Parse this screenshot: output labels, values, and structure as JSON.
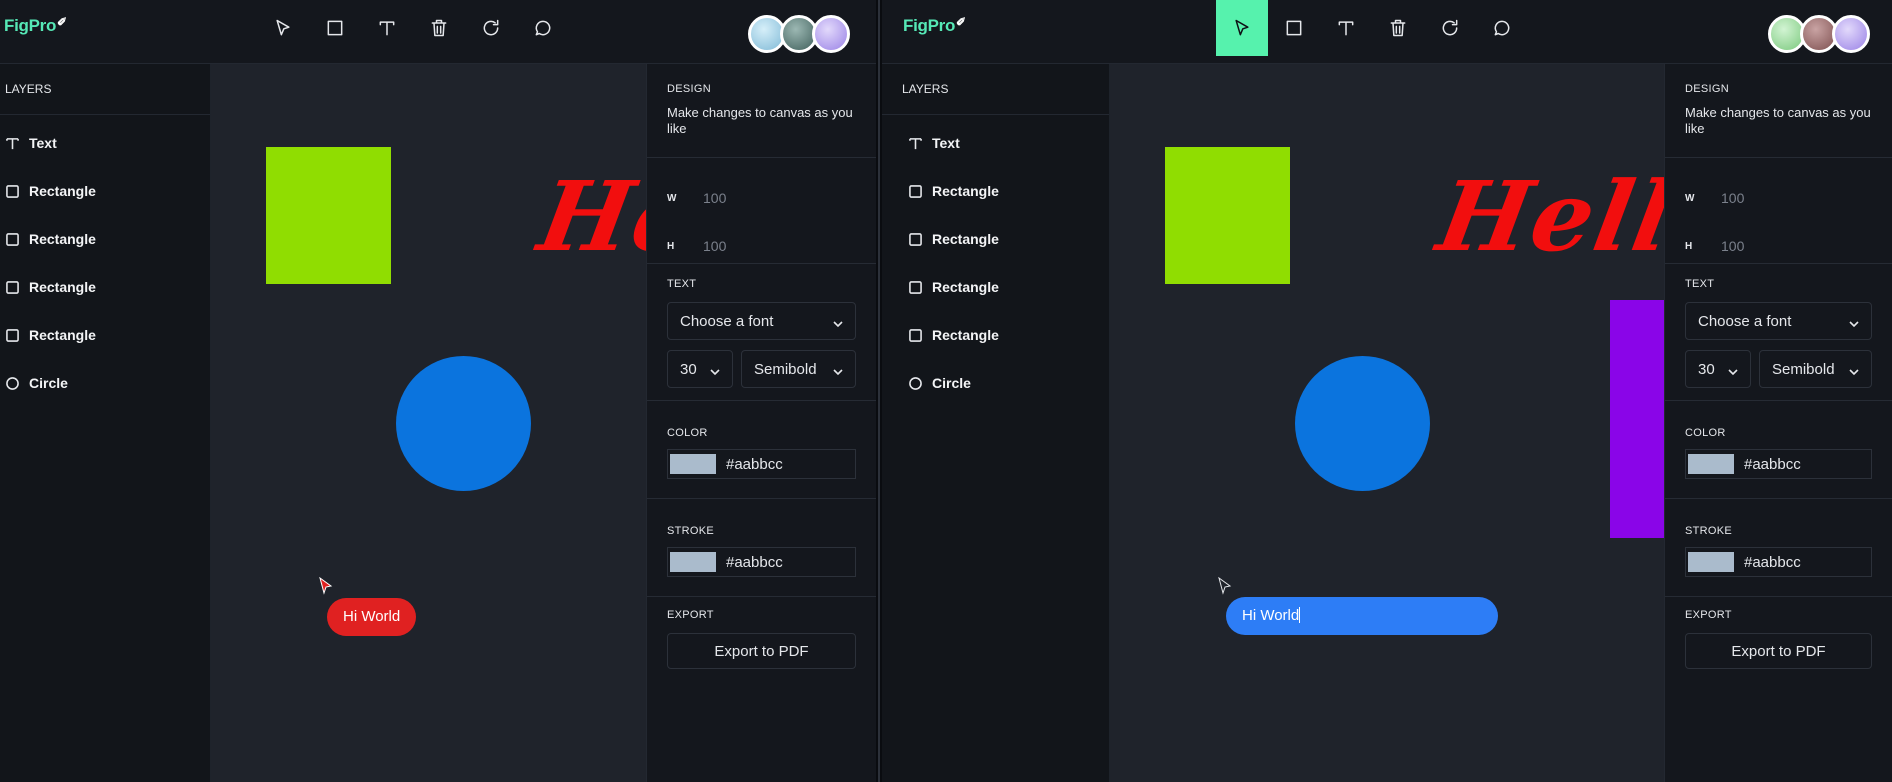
{
  "left_window": {
    "logo": "FigPro",
    "layers_title": "LAYERS",
    "layers": [
      {
        "label": "Text",
        "icon": "text-icon"
      },
      {
        "label": "Rectangle",
        "icon": "square-icon"
      },
      {
        "label": "Rectangle",
        "icon": "square-icon"
      },
      {
        "label": "Rectangle",
        "icon": "square-icon"
      },
      {
        "label": "Rectangle",
        "icon": "square-icon"
      },
      {
        "label": "Circle",
        "icon": "circle-icon"
      }
    ],
    "canvas": {
      "hello_text": "Hello",
      "comment_text": "Hi World"
    },
    "design": {
      "title": "DESIGN",
      "description": "Make changes to canvas as you like",
      "w_label": "W",
      "w_value": "100",
      "h_label": "H",
      "h_value": "100",
      "text_title": "TEXT",
      "font_placeholder": "Choose a font",
      "font_size": "30",
      "font_weight": "Semibold",
      "color_title": "COLOR",
      "color_value": "#aabbcc",
      "stroke_title": "STROKE",
      "stroke_value": "#aabbcc",
      "export_title": "EXPORT",
      "export_button": "Export to PDF"
    },
    "avatars": [
      "#a9d6ef",
      "#57807c",
      "#b8a6f0"
    ]
  },
  "right_window": {
    "logo": "FigPro",
    "active_tool": "select",
    "layers_title": "LAYERS",
    "layers": [
      {
        "label": "Text",
        "icon": "text-icon"
      },
      {
        "label": "Rectangle",
        "icon": "square-icon"
      },
      {
        "label": "Rectangle",
        "icon": "square-icon"
      },
      {
        "label": "Rectangle",
        "icon": "square-icon"
      },
      {
        "label": "Rectangle",
        "icon": "square-icon"
      },
      {
        "label": "Circle",
        "icon": "circle-icon"
      }
    ],
    "canvas": {
      "hello_text": "Hello",
      "comment_input_value": "Hi World"
    },
    "design": {
      "title": "DESIGN",
      "description": "Make changes to canvas as you like",
      "w_label": "W",
      "w_value": "100",
      "h_label": "H",
      "h_value": "100",
      "text_title": "TEXT",
      "font_placeholder": "Choose a font",
      "font_size": "30",
      "font_weight": "Semibold",
      "color_title": "COLOR",
      "color_value": "#aabbcc",
      "stroke_title": "STROKE",
      "stroke_value": "#aabbcc",
      "export_title": "EXPORT",
      "export_button": "Export to PDF"
    },
    "avatars": [
      "#9fe0a0",
      "#9a6e6e",
      "#b8a6f0"
    ]
  },
  "colors": {
    "accent": "#56f2ad",
    "green_rect": "#90dd01",
    "blue_circle": "#0b74de",
    "hello_red": "#f20e0e",
    "purple_rect": "#8a05e8",
    "comment_red": "#e02121",
    "comment_blue": "#2d7df6"
  }
}
